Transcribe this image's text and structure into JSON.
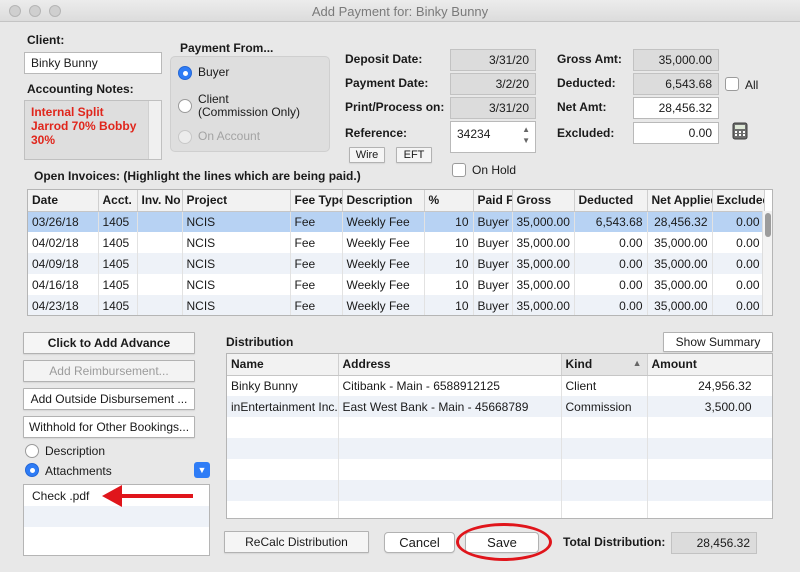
{
  "window": {
    "title": "Add Payment for: Binky Bunny"
  },
  "client": {
    "label": "Client:",
    "value": "Binky Bunny"
  },
  "accounting_notes": {
    "label": "Accounting Notes:",
    "text": "Internal Split Jarrod 70% Bobby 30%",
    "color": "#e0261c"
  },
  "payment_from": {
    "label": "Payment From...",
    "options": [
      "Buyer",
      "Client\n(Commission Only)",
      "On Account"
    ],
    "selected": "Buyer"
  },
  "dates": {
    "deposit_label": "Deposit Date:",
    "deposit_value": "3/31/20",
    "payment_label": "Payment Date:",
    "payment_value": "3/2/20",
    "print_label": "Print/Process on:",
    "print_value": "3/31/20",
    "reference_label": "Reference:",
    "reference_value": "34234",
    "wire_label": "Wire",
    "eft_label": "EFT",
    "on_hold_label": "On Hold"
  },
  "amounts": {
    "gross_label": "Gross Amt:",
    "gross_value": "35,000.00",
    "deducted_label": "Deducted:",
    "deducted_value": "6,543.68",
    "all_label": "All",
    "net_label": "Net Amt:",
    "net_value": "28,456.32",
    "excluded_label": "Excluded:",
    "excluded_value": "0.00"
  },
  "invoices": {
    "label": "Open Invoices: (Highlight the lines which are being paid.)",
    "columns": [
      "Date",
      "Acct.",
      "Inv. No",
      "Project",
      "Fee Type",
      "Description",
      "%",
      "Paid From",
      "Gross",
      "Deducted",
      "Net Applied",
      "Excluded"
    ],
    "rows": [
      [
        "03/26/18",
        "1405",
        "",
        "NCIS",
        "Fee",
        "Weekly Fee",
        "10",
        "Buyer",
        "35,000.00",
        "6,543.68",
        "28,456.32",
        "0.00"
      ],
      [
        "04/02/18",
        "1405",
        "",
        "NCIS",
        "Fee",
        "Weekly Fee",
        "10",
        "Buyer",
        "35,000.00",
        "0.00",
        "35,000.00",
        "0.00"
      ],
      [
        "04/09/18",
        "1405",
        "",
        "NCIS",
        "Fee",
        "Weekly Fee",
        "10",
        "Buyer",
        "35,000.00",
        "0.00",
        "35,000.00",
        "0.00"
      ],
      [
        "04/16/18",
        "1405",
        "",
        "NCIS",
        "Fee",
        "Weekly Fee",
        "10",
        "Buyer",
        "35,000.00",
        "0.00",
        "35,000.00",
        "0.00"
      ],
      [
        "04/23/18",
        "1405",
        "",
        "NCIS",
        "Fee",
        "Weekly Fee",
        "10",
        "Buyer",
        "35,000.00",
        "0.00",
        "35,000.00",
        "0.00"
      ]
    ]
  },
  "left_panel": {
    "add_advance": "Click to Add Advance",
    "add_reimbursement": "Add Reimbursement...",
    "add_outside": "Add Outside Disbursement ...",
    "withhold": "Withhold for Other Bookings...",
    "description_label": "Description",
    "attachments_label": "Attachments",
    "attachments": [
      "Check .pdf"
    ]
  },
  "distribution": {
    "label": "Distribution",
    "show_summary": "Show Summary",
    "columns": [
      "Name",
      "Address",
      "Kind",
      "Amount"
    ],
    "rows": [
      [
        "Binky Bunny",
        "Citibank - Main - 6588912125",
        "Client",
        "24,956.32"
      ],
      [
        "inEntertainment Inc.",
        "East West Bank - Main - 45668789",
        "Commission",
        "3,500.00"
      ]
    ]
  },
  "footer": {
    "recalc": "ReCalc Distribution",
    "cancel": "Cancel",
    "save": "Save",
    "total_label": "Total Distribution:",
    "total_value": "28,456.32"
  },
  "colors": {
    "accent": "#2e7cf6",
    "selected_row": "#b7d2f3",
    "annotation": "#e0151b"
  }
}
